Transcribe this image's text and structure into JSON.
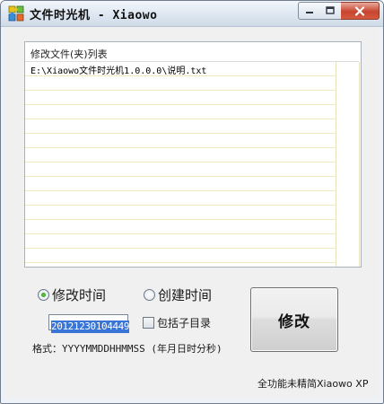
{
  "window": {
    "title": "文件时光机 - Xiaowo"
  },
  "icons": {
    "app": "puzzle-app-icon",
    "minimize": "minimize-icon",
    "maximize": "maximize-icon",
    "close": "close-icon"
  },
  "file_list": {
    "header": "修改文件(夹)列表",
    "items": [
      "E:\\Xiaowo文件时光机1.0.0.0\\说明.txt"
    ]
  },
  "time_type": {
    "modify_label": "修改时间",
    "create_label": "创建时间",
    "selected": "修改时间"
  },
  "datetime_input": {
    "value": "20121230104449"
  },
  "include_subdir": {
    "label": "包括子目录",
    "checked": false
  },
  "format_hint": "格式：YYYYMMDDHHMMSS (年月日时分秒)",
  "modify_button": {
    "label": "修改"
  },
  "footer": "全功能未精简Xiaowo XP",
  "colors": {
    "selection": "#3875d7",
    "close_button": "#c7452f",
    "radio_selected": "#1e7d16"
  }
}
